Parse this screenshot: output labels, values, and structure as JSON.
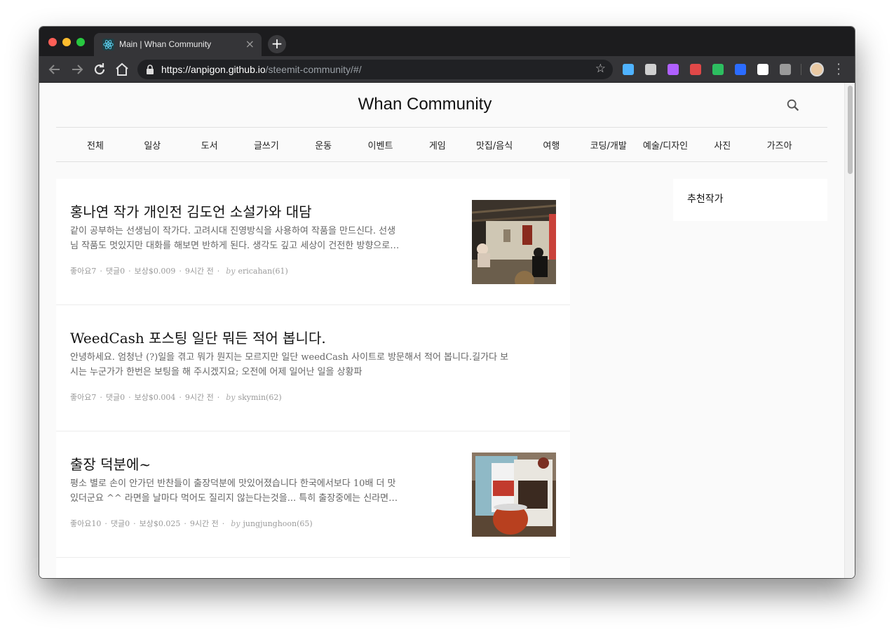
{
  "browser": {
    "tab_title": "Main | Whan Community",
    "tab_close": "×",
    "new_tab": "+",
    "url_host": "https://anpigon.github.io",
    "url_path": "/steemit-community/#/",
    "icons": [
      "back-icon",
      "forward-icon",
      "reload-icon",
      "home-icon",
      "lock-icon",
      "bookmark-star-icon"
    ],
    "extensions": [
      {
        "name": "sketch-diamond-extension-icon",
        "color": "#4fb3ff"
      },
      {
        "name": "note-pencil-extension-icon",
        "color": "#d0d0d0"
      },
      {
        "name": "feather-extension-icon",
        "color": "#b060ff"
      },
      {
        "name": "list-extension-icon",
        "color": "#e04848"
      },
      {
        "name": "evernote-extension-icon",
        "color": "#2dbe60"
      },
      {
        "name": "checkbox-extension-icon",
        "color": "#2b6cff"
      },
      {
        "name": "notion-extension-icon",
        "color": "#ffffff"
      },
      {
        "name": "record-extension-icon",
        "color": "#9a9a9a"
      }
    ]
  },
  "site": {
    "title": "Whan Community",
    "nav": [
      "전체",
      "일상",
      "도서",
      "글쓰기",
      "운동",
      "이벤트",
      "게임",
      "맛집/음식",
      "여행",
      "코딩/개발",
      "예술/디자인",
      "사진",
      "가즈아"
    ]
  },
  "posts": [
    {
      "title": "홍나연 작가 개인전 김도언 소설가와 대담",
      "excerpt_line1": "같이 공부하는 선생님이 작가다. 고려시대 진영방식을 사용하여 작품을 만드신다. 선생",
      "excerpt_line2": "님 작품도 멋있지만 대화를 해보면 반하게 된다. 생각도 깊고 세상이 건전한 방향으로…",
      "likes": "좋아요7",
      "comments": "댓글0",
      "reward": "보상$0.009",
      "time": "9시간 전",
      "by": "by",
      "author": "ericahan(61)",
      "has_thumb": true
    },
    {
      "title": "WeedCash 포스팅 일단 뭐든 적어 봅니다.",
      "excerpt_line1": "안녕하세요. 엄청난 (?)일을 겪고 뭐가 뭔지는 모르지만 일단 weedCash 사이트로 방문해서 적어 봅니다.길가다 보",
      "excerpt_line2": "시는 누군가가 한번은 보팅을 해 주시겠지요; 오전에 어제 일어난 일을 상황파",
      "likes": "좋아요7",
      "comments": "댓글0",
      "reward": "보상$0.004",
      "time": "9시간 전",
      "by": "by",
      "author": "skymin(62)",
      "has_thumb": false
    },
    {
      "title": "출장 덕분에~",
      "excerpt_line1": "평소 별로 손이 안가던 반찬들이 출장덕분에 맛있어졌습니다 한국에서보다 10배 더 맛",
      "excerpt_line2": "있더군요 ^^ 라면을 날마다 먹어도 질리지 않는다는것을... 특히 출장중에는 신라면…",
      "likes": "좋아요10",
      "comments": "댓글0",
      "reward": "보상$0.025",
      "time": "9시간 전",
      "by": "by",
      "author": "jungjunghoon(65)",
      "has_thumb": true
    }
  ],
  "sidebar": {
    "title": "추천작가"
  }
}
